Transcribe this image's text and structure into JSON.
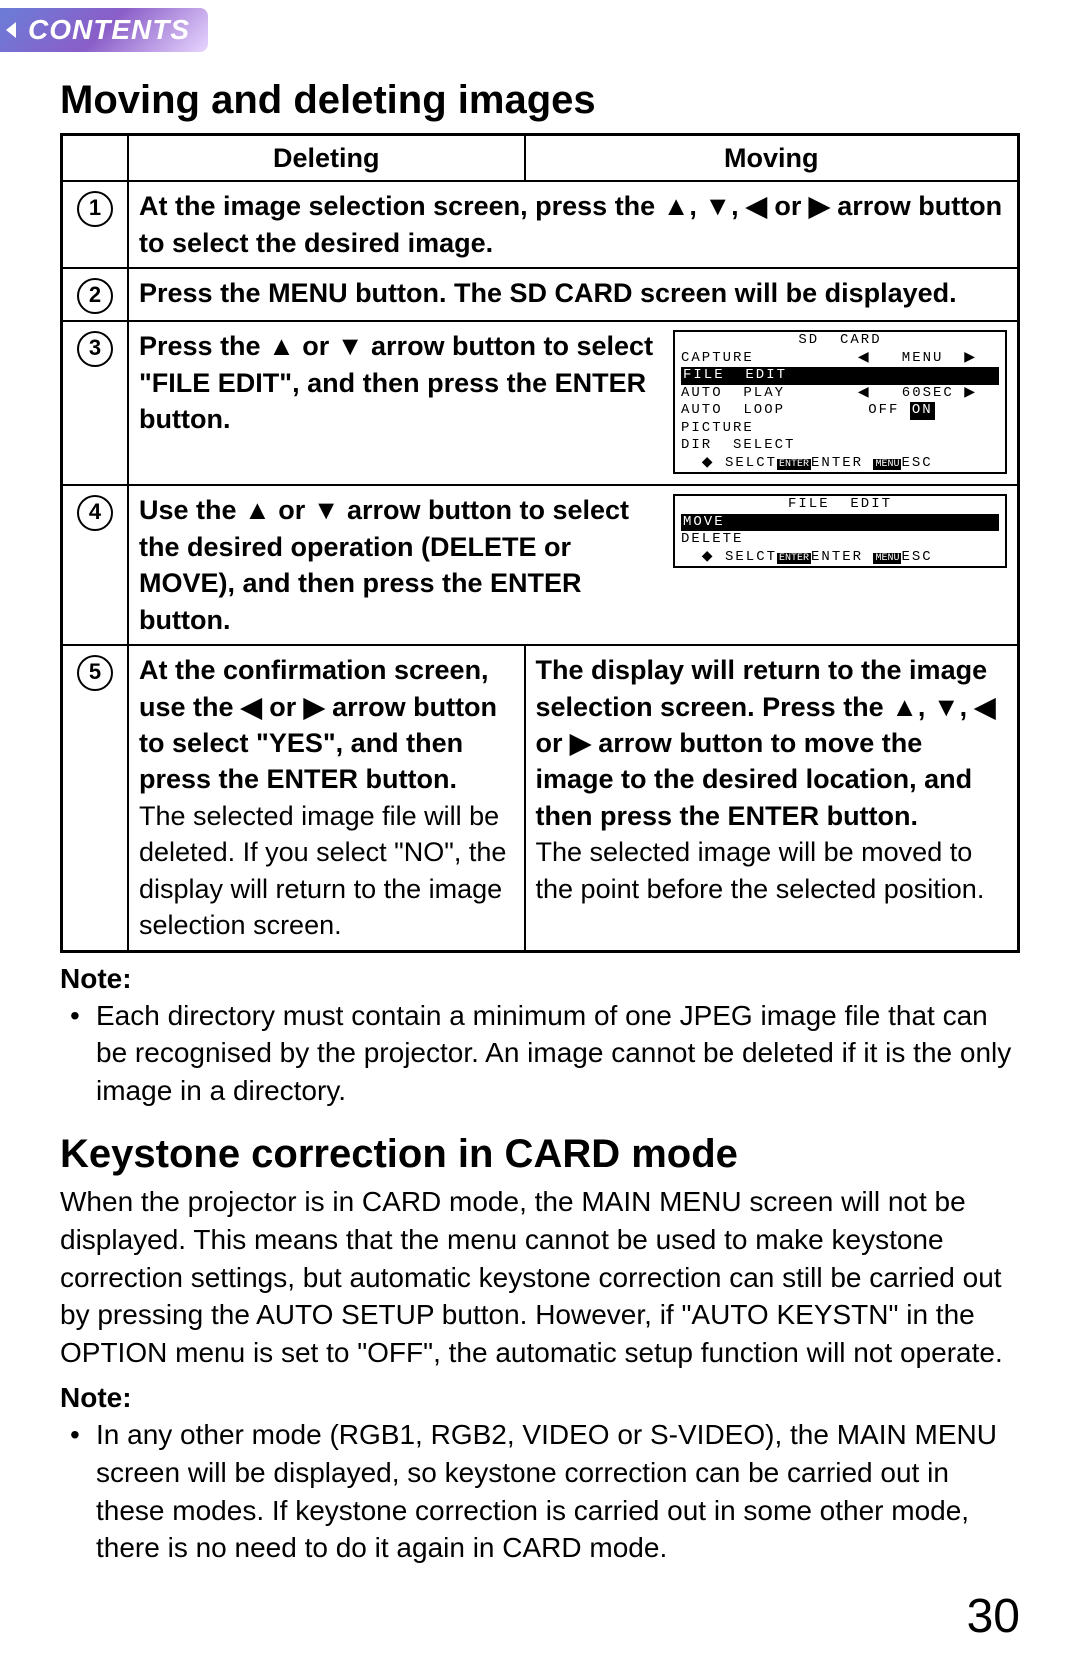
{
  "contents_label": "CONTENTS",
  "heading1": "Moving and deleting images",
  "table_headers": {
    "delete": "Deleting",
    "move": "Moving"
  },
  "steps": {
    "s1": {
      "num": "1",
      "text_a": "At the image selection screen, press the ",
      "arrows": "▲, ▼, ◀ or ▶",
      "text_b": " arrow button to select the desired image."
    },
    "s2": {
      "num": "2",
      "text": "Press the MENU button. The SD CARD screen will be displayed."
    },
    "s3": {
      "num": "3",
      "text_a": "Press the ",
      "arrows": "▲ or ▼",
      "text_b": " arrow button to select \"FILE EDIT\", and then press the ENTER button."
    },
    "s4": {
      "num": "4",
      "text_a": "Use the ",
      "arrows": "▲ or ▼",
      "text_b": " arrow button to select the desired operation (DELETE or MOVE), and then press the ENTER button."
    },
    "s5": {
      "num": "5",
      "delete_bold_a": "At the confirmation screen, use the  ",
      "delete_arrows": "◀ or ▶",
      "delete_bold_b": "  arrow button to select \"YES\", and then press the ENTER button.",
      "delete_plain": "The selected image file will be deleted. If you select \"NO\", the display will return to the image selection screen.",
      "move_bold_a": "The display will return to the image selection screen. Press the ",
      "move_arrows": "▲, ▼, ◀ or ▶",
      "move_bold_b": "  arrow button to move the image to the desired location, and then press the ENTER button.",
      "move_plain": "The selected image will be moved to the point before the selected position."
    }
  },
  "osd1": {
    "title": "SD  CARD",
    "r1_left": "CAPTURE",
    "r1_right": "MENU",
    "r2": "FILE  EDIT",
    "r3_left": "AUTO  PLAY",
    "r3_right": "60SEC",
    "r4_left": "AUTO  LOOP",
    "r4_off": "OFF",
    "r4_on": "ON",
    "r5": "PICTURE",
    "r6": "DIR  SELECT",
    "foot_select": "SELCT",
    "foot_enter_tag": "ENTER",
    "foot_enter": "ENTER",
    "foot_menu_tag": "MENU",
    "foot_esc": "ESC"
  },
  "osd2": {
    "title": "FILE  EDIT",
    "r1": "MOVE",
    "r2": "DELETE",
    "foot_select": "SELCT",
    "foot_enter_tag": "ENTER",
    "foot_enter": "ENTER",
    "foot_menu_tag": "MENU",
    "foot_esc": "ESC"
  },
  "note1_label": "Note:",
  "note1_text": "Each directory must contain a minimum of one JPEG image file that can be recognised by the projector. An image cannot be deleted if it is the only image in a directory.",
  "heading2": "Keystone correction in CARD mode",
  "keystone_para": "When the projector is in CARD mode, the MAIN MENU screen will not be displayed. This means that the menu cannot be used to make keystone correction settings, but automatic keystone correction can still be carried out by pressing the AUTO SETUP button.  However, if \"AUTO KEYSTN\" in the OPTION menu is set to \"OFF\", the automatic setup function will not operate.",
  "note2_label": "Note:",
  "note2_text": "In any other mode (RGB1, RGB2, VIDEO or S-VIDEO), the MAIN MENU screen will be displayed, so keystone correction can be carried out in these modes. If keystone correction is carried out in some other mode, there is no need to do it again in CARD mode.",
  "page_number": "30"
}
